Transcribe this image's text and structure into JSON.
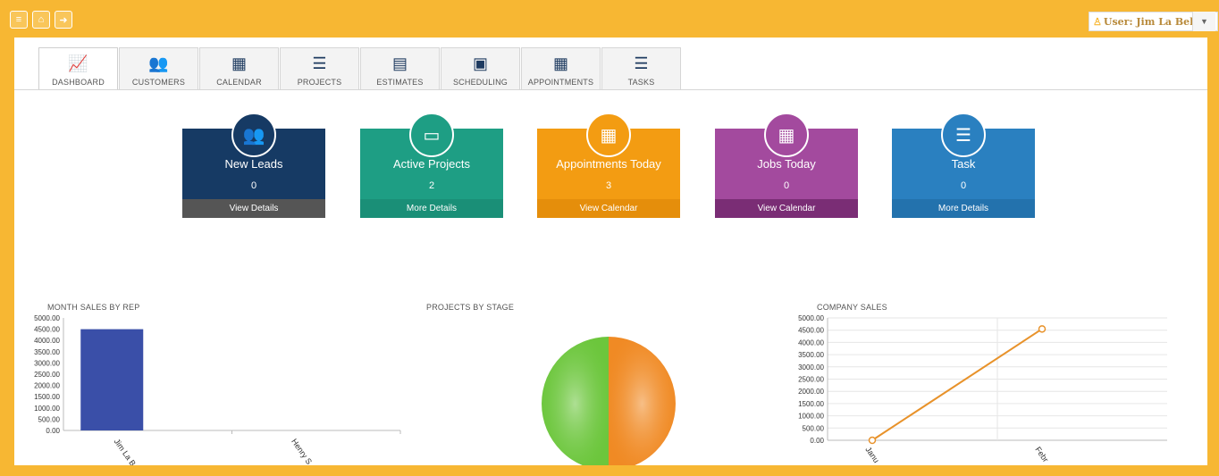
{
  "header": {
    "user_label": "User: Jim La Belle",
    "buttons": [
      "menu-icon",
      "home-icon",
      "logout-icon"
    ]
  },
  "tabs": [
    {
      "label": "DASHBOARD",
      "icon": "chart-line-icon",
      "glyph": "📈"
    },
    {
      "label": "CUSTOMERS",
      "icon": "users-icon",
      "glyph": "👥"
    },
    {
      "label": "CALENDAR",
      "icon": "calendar-icon",
      "glyph": "▦"
    },
    {
      "label": "PROJECTS",
      "icon": "list-icon",
      "glyph": "☰"
    },
    {
      "label": "ESTIMATES",
      "icon": "file-pdf-icon",
      "glyph": "▤"
    },
    {
      "label": "SCHEDULING",
      "icon": "clipboard-icon",
      "glyph": "▣"
    },
    {
      "label": "APPOINTMENTS",
      "icon": "calendar-icon",
      "glyph": "▦"
    },
    {
      "label": "TASKS",
      "icon": "list-icon",
      "glyph": "☰"
    }
  ],
  "cards": [
    {
      "title": "New Leads",
      "count": "0",
      "footer": "View Details",
      "color": "#163a64",
      "footer_color": "#555555",
      "icon": "users-icon",
      "glyph": "👥"
    },
    {
      "title": "Active Projects",
      "count": "2",
      "footer": "More Details",
      "color": "#1e9e84",
      "footer_color": "#1a8f77",
      "icon": "money-icon",
      "glyph": "▭"
    },
    {
      "title": "Appointments Today",
      "count": "3",
      "footer": "View Calendar",
      "color": "#f39c12",
      "footer_color": "#e58e0b",
      "icon": "calendar-icon",
      "glyph": "▦"
    },
    {
      "title": "Jobs Today",
      "count": "0",
      "footer": "View Calendar",
      "color": "#a34a9e",
      "footer_color": "#7a2d75",
      "icon": "calendar-icon",
      "glyph": "▦"
    },
    {
      "title": "Task",
      "count": "0",
      "footer": "More Details",
      "color": "#2a80c0",
      "footer_color": "#2372ad",
      "icon": "tasks-icon",
      "glyph": "☰"
    }
  ],
  "chart_data": [
    {
      "type": "bar",
      "title": "MONTH SALES BY REP",
      "categories": [
        "Jim La B",
        "Henry S"
      ],
      "values": [
        4500,
        0
      ],
      "ylim": [
        0,
        5000
      ],
      "yticks": [
        "5000.00",
        "4500.00",
        "4000.00",
        "3500.00",
        "3000.00",
        "2500.00",
        "2000.00",
        "1500.00",
        "1000.00",
        "500.00",
        "0.00"
      ],
      "color": "#3a4fa8"
    },
    {
      "type": "pie",
      "title": "PROJECTS BY STAGE",
      "values": [
        1,
        1
      ],
      "colors": [
        "#6cc63c",
        "#f08a24"
      ]
    },
    {
      "type": "line",
      "title": "COMPANY SALES",
      "categories": [
        "Janu",
        "Febr"
      ],
      "values": [
        0,
        4550
      ],
      "ylim": [
        0,
        5000
      ],
      "yticks": [
        "5000.00",
        "4500.00",
        "4000.00",
        "3500.00",
        "3000.00",
        "2500.00",
        "2000.00",
        "1500.00",
        "1000.00",
        "500.00",
        "0.00"
      ],
      "color": "#e8922a"
    }
  ]
}
